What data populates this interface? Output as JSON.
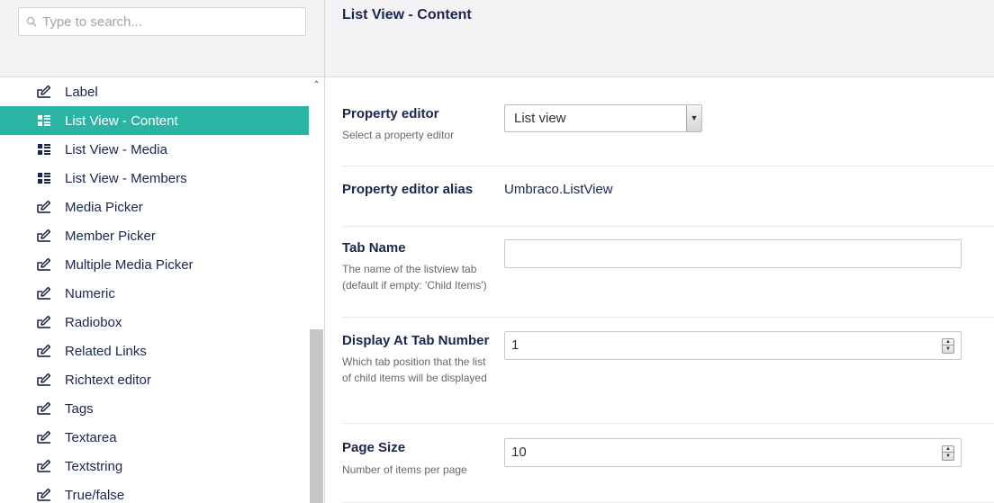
{
  "search": {
    "placeholder": "Type to search..."
  },
  "tree": {
    "items": [
      {
        "label": "Label",
        "icon": "edit-icon",
        "active": false
      },
      {
        "label": "List View - Content",
        "icon": "grid-list-icon",
        "active": true
      },
      {
        "label": "List View - Media",
        "icon": "grid-list-icon",
        "active": false
      },
      {
        "label": "List View - Members",
        "icon": "grid-list-icon",
        "active": false
      },
      {
        "label": "Media Picker",
        "icon": "edit-icon",
        "active": false
      },
      {
        "label": "Member Picker",
        "icon": "edit-icon",
        "active": false
      },
      {
        "label": "Multiple Media Picker",
        "icon": "edit-icon",
        "active": false
      },
      {
        "label": "Numeric",
        "icon": "edit-icon",
        "active": false
      },
      {
        "label": "Radiobox",
        "icon": "edit-icon",
        "active": false
      },
      {
        "label": "Related Links",
        "icon": "edit-icon",
        "active": false
      },
      {
        "label": "Richtext editor",
        "icon": "edit-icon",
        "active": false
      },
      {
        "label": "Tags",
        "icon": "edit-icon",
        "active": false
      },
      {
        "label": "Textarea",
        "icon": "edit-icon",
        "active": false
      },
      {
        "label": "Textstring",
        "icon": "edit-icon",
        "active": false
      },
      {
        "label": "True/false",
        "icon": "edit-icon",
        "active": false
      }
    ]
  },
  "header": {
    "title": "List View - Content"
  },
  "form": {
    "property_editor": {
      "label": "Property editor",
      "description": "Select a property editor",
      "value": "List view"
    },
    "property_editor_alias": {
      "label": "Property editor alias",
      "value": "Umbraco.ListView"
    },
    "tab_name": {
      "label": "Tab Name",
      "description": "The name of the listview tab (default if empty: 'Child Items')",
      "value": ""
    },
    "display_at_tab_number": {
      "label": "Display At Tab Number",
      "description": "Which tab position that the list of child items will be displayed",
      "value": "1"
    },
    "page_size": {
      "label": "Page Size",
      "description": "Number of items per page",
      "value": "10"
    }
  },
  "colors": {
    "accent": "#2bb3a3",
    "text": "#1b264f",
    "panel_bg": "#f3f3f5"
  }
}
